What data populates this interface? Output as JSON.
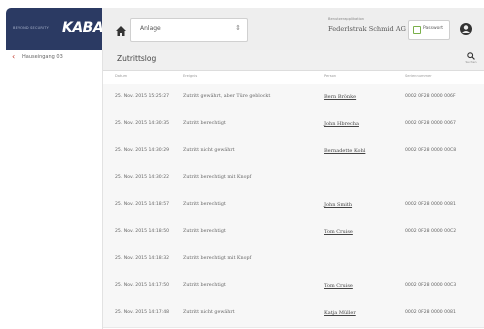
{
  "brand": {
    "subtitle": "BEYOND SECURITY",
    "logo": "KABA"
  },
  "header": {
    "selector_label": "Anlage",
    "app_label": "Benutzerapplikation",
    "app_name": "Federlstrak Schmid AG",
    "password_button": "Passwort"
  },
  "sidebar": {
    "back_label": "Hauseingang 03"
  },
  "main": {
    "title": "Zutrittslog",
    "search_label": "Suchen",
    "columns": [
      "Datum",
      "Ereignis",
      "Person",
      "Seriennummer"
    ],
    "rows": [
      {
        "date": "25. Nov. 2015 15:25:27",
        "event": "Zutritt gewährt, aber Türe geblockt",
        "person": "Bern Brönke",
        "serial": "0002 0F28 0000 006F"
      },
      {
        "date": "25. Nov. 2015 14:30:35",
        "event": "Zutritt berechtigt",
        "person": "John Hbrecha",
        "serial": "0002 0F28 0000 0067"
      },
      {
        "date": "25. Nov. 2015 14:30:29",
        "event": "Zutritt nicht gewährt",
        "person": "Bernadette Kohl",
        "serial": "0002 0F28 0000 00C8"
      },
      {
        "date": "25. Nov. 2015 14:30:22",
        "event": "Zutritt berechtigt mit Knopf",
        "person": "",
        "serial": ""
      },
      {
        "date": "25. Nov. 2015 14:18:57",
        "event": "Zutritt berechtigt",
        "person": "John Smith",
        "serial": "0002 0F28 0000 0081"
      },
      {
        "date": "25. Nov. 2015 14:18:50",
        "event": "Zutritt berechtigt",
        "person": "Tom Cruise",
        "serial": "0002 0F28 0000 00C2"
      },
      {
        "date": "25. Nov. 2015 14:18:32",
        "event": "Zutritt berechtigt mit Knopf",
        "person": "",
        "serial": ""
      },
      {
        "date": "25. Nov. 2015 14:17:50",
        "event": "Zutritt berechtigt",
        "person": "Tom Cruise",
        "serial": "0002 0F28 0000 00C3"
      },
      {
        "date": "25. Nov. 2015 14:17:48",
        "event": "Zutritt nicht gewährt",
        "person": "Katja Müller",
        "serial": "0002 0F28 0000 0081"
      }
    ]
  },
  "colors": {
    "brand_bg": "#2b3a63",
    "back_chevron": "#c0392b",
    "password_icon": "#7ab04a"
  }
}
